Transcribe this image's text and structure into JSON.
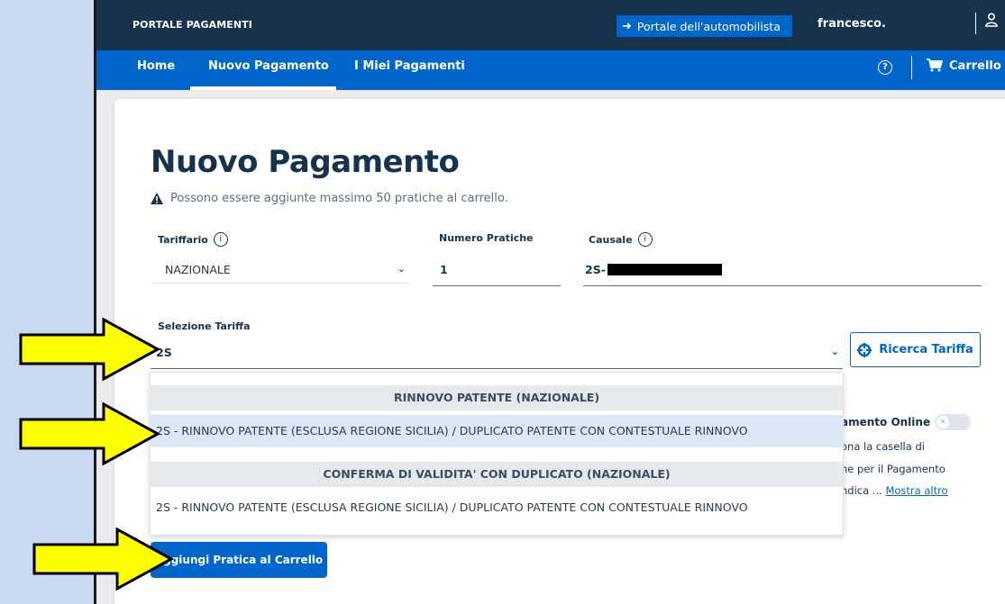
{
  "header": {
    "brand": "PORTALE PAGAMENTI",
    "portal_button": "Portale dell'automobilista",
    "username": "francesco.",
    "icons": {
      "portal": "sign-in-icon",
      "user": "user-icon"
    }
  },
  "nav": {
    "items": [
      "Home",
      "Nuovo Pagamento",
      "I Miei Pagamenti"
    ],
    "active": "Nuovo Pagamento",
    "cart_label": "Carrello"
  },
  "page": {
    "title": "Nuovo Pagamento",
    "warning": "Possono essere aggiunte massimo 50 pratiche al carrello."
  },
  "form": {
    "tariffario": {
      "label": "Tariffario",
      "value": "NAZIONALE"
    },
    "numero_pratiche": {
      "label": "Numero Pratiche",
      "value": "1"
    },
    "causale": {
      "label": "Causale",
      "value": "2S-"
    },
    "selezione_tariffa": {
      "label": "Selezione Tariffa",
      "value": "2S"
    },
    "search_button": "Ricerca Tariffa",
    "add_button": "Aggiungi Pratica al Carrello"
  },
  "side_panel": {
    "title_partial": "amento Online",
    "line1": "ona la casella di",
    "line2": "ne per il Pagamento",
    "line3": "ndica ...",
    "link": "Mostra altro"
  },
  "dropdown": {
    "groups": [
      {
        "header": "RINNOVO PATENTE (NAZIONALE)",
        "option": "2S - RINNOVO PATENTE (ESCLUSA REGIONE SICILIA) / DUPLICATO PATENTE CON CONTESTUALE RINNOVO",
        "selected": true
      },
      {
        "header": "CONFERMA DI VALIDITA' CON DUPLICATO (NAZIONALE)",
        "option": "2S - RINNOVO PATENTE (ESCLUSA REGIONE SICILIA) / DUPLICATO PATENTE CON CONTESTUALE RINNOVO",
        "selected": false
      }
    ]
  },
  "colors": {
    "topbar": "#17324d",
    "navbar": "#0066cc",
    "accent": "#0066cc",
    "arrow_fill": "#ffff00"
  }
}
